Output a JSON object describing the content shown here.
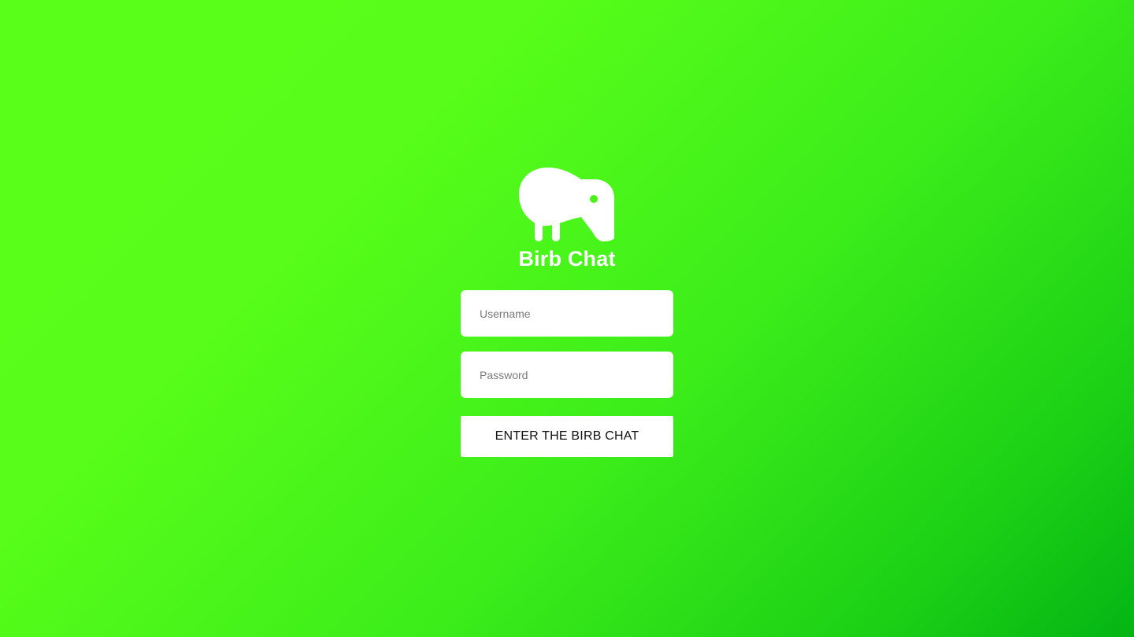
{
  "app": {
    "title": "Birb Chat",
    "logo_icon": "kiwi-bird-icon"
  },
  "form": {
    "username_placeholder": "Username",
    "username_value": "",
    "password_placeholder": "Password",
    "password_value": "",
    "submit_label": "ENTER THE BIRB CHAT"
  },
  "colors": {
    "background_start": "#5aff19",
    "background_end": "#04b514",
    "foreground": "#ffffff",
    "button_text": "#111111"
  }
}
